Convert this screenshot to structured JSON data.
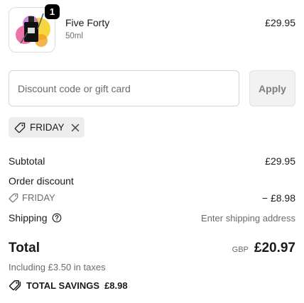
{
  "product": {
    "title": "Five Forty",
    "variant": "50ml",
    "price": "£29.95",
    "quantity": "1"
  },
  "discount": {
    "placeholder": "Discount code or gift card",
    "apply_label": "Apply",
    "applied_code": "FRIDAY"
  },
  "summary": {
    "subtotal_label": "Subtotal",
    "subtotal_value": "£29.95",
    "order_discount_label": "Order discount",
    "discount_code": "FRIDAY",
    "discount_value": "− £8.98",
    "shipping_label": "Shipping",
    "shipping_value": "Enter shipping address",
    "total_label": "Total",
    "currency": "GBP",
    "total_value": "£20.97",
    "taxes_note": "Including £3.50 in taxes",
    "savings_label": "TOTAL SAVINGS",
    "savings_value": "£8.98"
  },
  "colors": {
    "text": "#1a1a1a",
    "muted": "#6b6b6b",
    "chip_bg": "#ededed",
    "button_bg": "#f2f2f2",
    "badge_bg": "#000000"
  },
  "icons": [
    "perfume-bottle-image",
    "tag-icon",
    "close-icon",
    "help-circle-icon",
    "tags-icon"
  ]
}
